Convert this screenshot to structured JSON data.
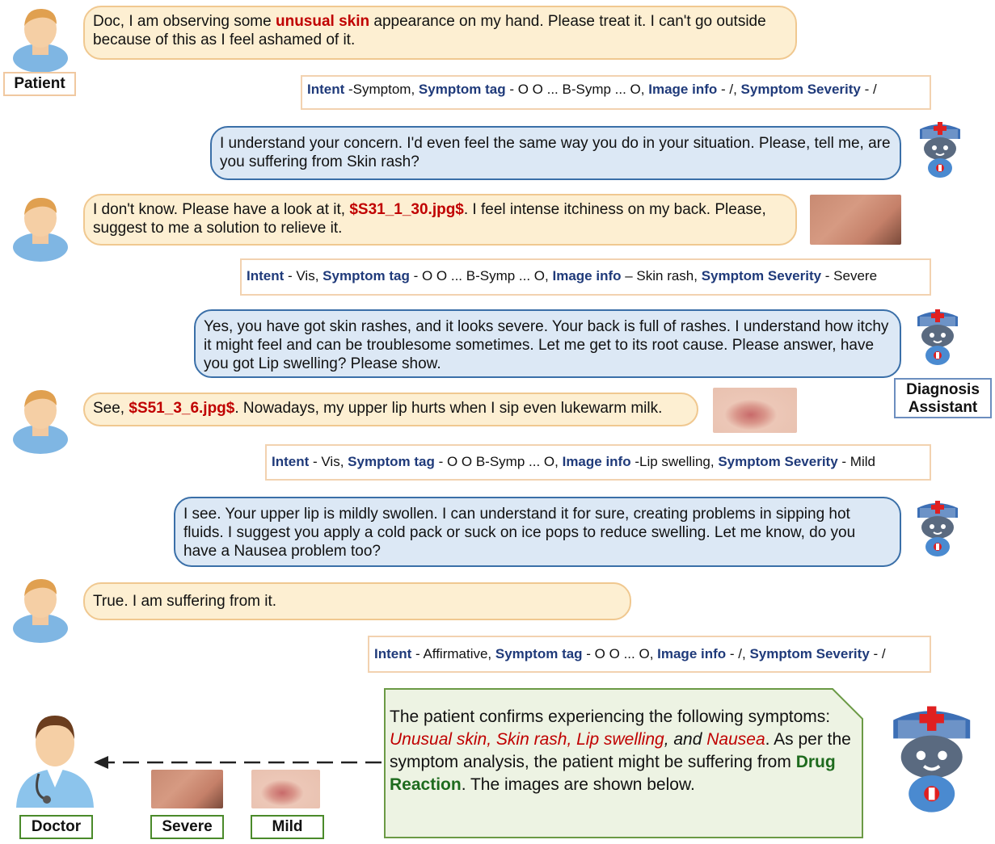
{
  "labels": {
    "patient": "Patient",
    "assistant_line1": "Diagnosis",
    "assistant_line2": "Assistant",
    "doctor": "Doctor",
    "severe": "Severe",
    "mild": "Mild"
  },
  "dialogue": {
    "p1": {
      "a": "Doc, I am observing some ",
      "b": "unusual skin",
      "c": " appearance on my hand. Please treat it. I can't go outside because of this as I feel ashamed of it."
    },
    "i1": {
      "k1": "Intent",
      "v1": " -Symptom, ",
      "k2": "Symptom tag",
      "v2": " - O O ... B-Symp ... O, ",
      "k3": "Image info",
      "v3": " - /, ",
      "k4": "Symptom Severity",
      "v4": " - /"
    },
    "b1": "I understand your concern. I'd even feel the same way you do in your situation. Please, tell me, are you suffering from Skin rash?",
    "p2": {
      "a": "I don't know. Please have a look at it, ",
      "b": "$S31_1_30.jpg$",
      "c": ". I feel intense itchiness on my back. Please, suggest to me a solution to relieve it."
    },
    "i2": {
      "k1": "Intent",
      "v1": " - Vis, ",
      "k2": "Symptom tag",
      "v2": " - O O ... B-Symp ... O, ",
      "k3": "Image info",
      "v3": " – Skin rash, ",
      "k4": "Symptom Severity",
      "v4": " - Severe"
    },
    "b2": "Yes, you have got skin rashes, and it looks severe. Your back is full of rashes. I understand how itchy it might feel and can be troublesome sometimes. Let me get to its root cause. Please answer, have you got Lip swelling? Please show.",
    "p3": {
      "a": "See, ",
      "b": "$S51_3_6.jpg$",
      "c": ". Nowadays, my upper lip hurts when I sip even lukewarm milk."
    },
    "i3": {
      "k1": "Intent",
      "v1": " - Vis, ",
      "k2": "Symptom tag",
      "v2": " - O O B-Symp ... O, ",
      "k3": "Image info",
      "v3": " -Lip swelling, ",
      "k4": "Symptom Severity",
      "v4": " - Mild"
    },
    "b3": "I see. Your upper lip is mildly swollen. I can understand it for sure, creating problems in sipping hot fluids. I suggest you apply a cold pack or suck on ice pops to reduce swelling. Let me know, do you have a Nausea problem too?",
    "p4": "True. I am suffering from it.",
    "i4": {
      "k1": "Intent",
      "v1": " - Affirmative, ",
      "k2": "Symptom tag",
      "v2": " - O O ... O, ",
      "k3": "Image info",
      "v3": " - /, ",
      "k4": "Symptom Severity",
      "v4": " - /"
    }
  },
  "summary": {
    "t1": "The patient confirms experiencing the following symptoms: ",
    "s1": "Unusual skin",
    "c1": ", ",
    "s2": "Skin rash",
    "c2": ", ",
    "s3": "Lip swelling",
    "c3": ", and ",
    "s4": "Nausea",
    "t2": ". As per the symptom analysis, the patient might be suffering from ",
    "dx": "Drug Reaction",
    "t3": ". The images are shown below."
  }
}
